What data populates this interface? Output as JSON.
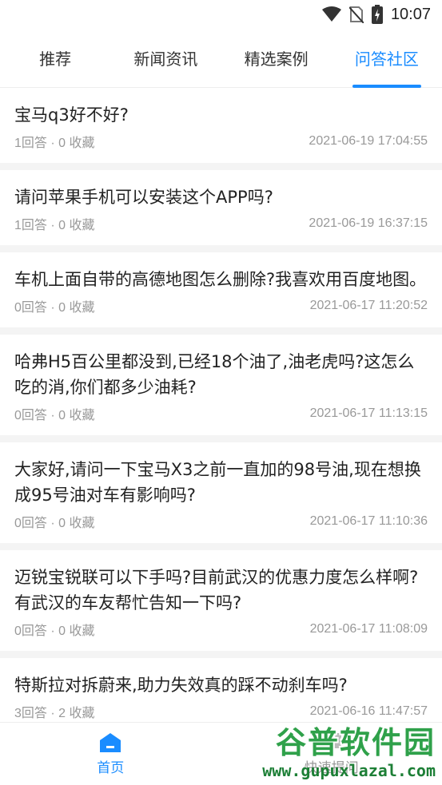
{
  "status_bar": {
    "time": "10:07",
    "icons": [
      "wifi-icon",
      "no-sim-icon",
      "battery-charging-icon"
    ]
  },
  "tabs": [
    {
      "label": "推荐",
      "active": false
    },
    {
      "label": "新闻资讯",
      "active": false
    },
    {
      "label": "精选案例",
      "active": false
    },
    {
      "label": "问答社区",
      "active": true
    }
  ],
  "questions": [
    {
      "title": "宝马q3好不好?",
      "stats": "1回答 · 0 收藏",
      "time": "2021-06-19 17:04:55"
    },
    {
      "title": "请问苹果手机可以安装这个APP吗?",
      "stats": "1回答 · 0 收藏",
      "time": "2021-06-19 16:37:15"
    },
    {
      "title": "车机上面自带的高德地图怎么删除?我喜欢用百度地图。",
      "stats": "0回答 · 0 收藏",
      "time": "2021-06-17 11:20:52"
    },
    {
      "title": "哈弗H5百公里都没到,已经18个油了,油老虎吗?这怎么吃的消,你们都多少油耗?",
      "stats": "0回答 · 0 收藏",
      "time": "2021-06-17 11:13:15"
    },
    {
      "title": "大家好,请问一下宝马X3之前一直加的98号油,现在想换成95号油对车有影响吗?",
      "stats": "0回答 · 0 收藏",
      "time": "2021-06-17 11:10:36"
    },
    {
      "title": "迈锐宝锐联可以下手吗?目前武汉的优惠力度怎么样啊?有武汉的车友帮忙告知一下吗?",
      "stats": "0回答 · 0 收藏",
      "time": "2021-06-17 11:08:09"
    },
    {
      "title": "特斯拉对拆蔚来,助力失效真的踩不动刹车吗?",
      "stats": "3回答 · 2 收藏",
      "time": "2021-06-16 11:47:57"
    }
  ],
  "bottom_nav": [
    {
      "label": "首页",
      "icon": "home-icon",
      "active": true
    },
    {
      "label": "快速提问",
      "icon": "question-icon",
      "active": false
    }
  ],
  "watermark": {
    "name": "谷普软件园",
    "url": "www.gupuxlazal.com"
  },
  "colors": {
    "accent": "#1a8cff",
    "muted": "#999999",
    "watermark_green": "#2fa14a"
  }
}
